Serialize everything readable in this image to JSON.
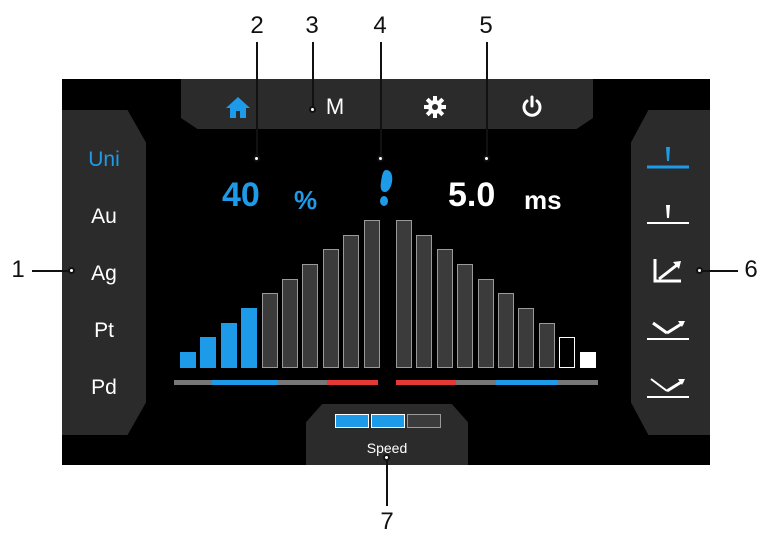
{
  "callouts": [
    "1",
    "2",
    "3",
    "4",
    "5",
    "6",
    "7"
  ],
  "topbar": {
    "home_icon": "home-icon",
    "mode_label": "M",
    "settings_icon": "gear-icon",
    "power_icon": "power-icon"
  },
  "materials": {
    "items": [
      "Uni",
      "Au",
      "Ag",
      "Pt",
      "Pd"
    ],
    "selected": "Uni"
  },
  "readouts": {
    "power_value": "40",
    "power_unit": "%",
    "pulse_value": "5.0",
    "pulse_unit": "ms",
    "trigger_icon": "footprint-icon"
  },
  "power_level": {
    "bars_total": 10,
    "bars_active": 4,
    "percent": 40
  },
  "pulse_level": {
    "bars_total": 10,
    "bars_active": 1
  },
  "speed": {
    "label": "Speed",
    "segments_total": 3,
    "segments_active": 2
  },
  "waveforms": {
    "items": [
      "waveform-pulse-tall-icon",
      "waveform-pulse-short-icon",
      "waveform-ramp-down-icon",
      "waveform-v-icon",
      "waveform-v-wide-icon"
    ],
    "selected_index": 0
  },
  "colors": {
    "accent": "#1e9be8",
    "alert": "#e53935",
    "panel": "#2b2b2b",
    "screen": "#000000"
  }
}
